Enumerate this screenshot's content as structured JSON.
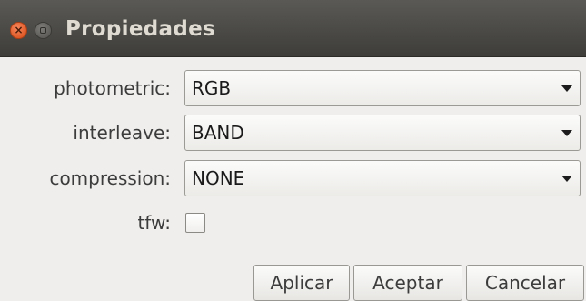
{
  "window": {
    "title": "Propiedades"
  },
  "fields": {
    "photometric": {
      "label": "photometric:",
      "value": "RGB"
    },
    "interleave": {
      "label": "interleave:",
      "value": "BAND"
    },
    "compression": {
      "label": "compression:",
      "value": "NONE"
    },
    "tfw": {
      "label": "tfw:",
      "checked": false
    }
  },
  "buttons": {
    "apply": "Aplicar",
    "accept": "Aceptar",
    "cancel": "Cancelar"
  },
  "colors": {
    "titlebar": "#3e3d39",
    "close": "#e05a27",
    "background": "#efeeec"
  }
}
